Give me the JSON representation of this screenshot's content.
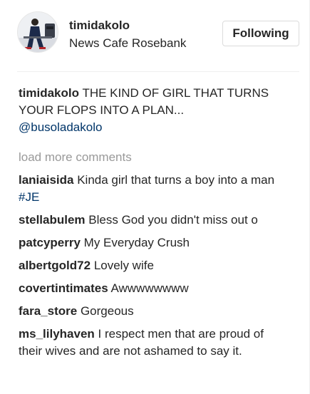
{
  "post": {
    "author": "timidakolo",
    "location": "News Cafe Rosebank",
    "follow_label": "Following",
    "avatar_icon": "profile-photo"
  },
  "caption": {
    "author": "timidakolo",
    "text": "THE KIND OF GIRL THAT TURNS YOUR FLOPS INTO A PLAN...",
    "mention": "@busoladakolo"
  },
  "load_more_label": "load more comments",
  "comments": [
    {
      "user": "laniaisida",
      "text": "Kinda girl that turns a boy into a man",
      "tag": "#JE"
    },
    {
      "user": "stellabulem",
      "text": "Bless God you didn't miss out o",
      "tag": ""
    },
    {
      "user": "patcyperry",
      "text": "My Everyday Crush",
      "tag": ""
    },
    {
      "user": "albertgold72",
      "text": "Lovely wife",
      "tag": ""
    },
    {
      "user": "covertintimates",
      "text": "Awwwwwwww",
      "tag": ""
    },
    {
      "user": "fara_store",
      "text": "Gorgeous",
      "tag": ""
    },
    {
      "user": "ms_lilyhaven",
      "text": "I respect men that are proud of their wives and are not ashamed to say it.",
      "tag": ""
    }
  ],
  "colors": {
    "link": "#003569",
    "muted": "#999999",
    "text": "#262626",
    "border": "#dbdbdb"
  }
}
